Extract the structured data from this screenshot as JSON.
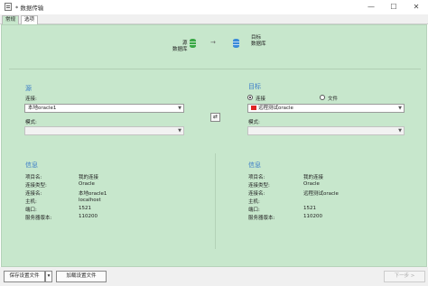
{
  "window": {
    "title": "* 数据传输",
    "minimize": "—",
    "maximize": "☐",
    "close": "✕"
  },
  "tabs": [
    {
      "label": "常规",
      "active": true
    },
    {
      "label": "选项",
      "active": false
    }
  ],
  "banner": {
    "source_label_1": "源",
    "source_label_2": "数据库",
    "target_label_1": "目标",
    "target_label_2": "数据库",
    "arrow": "→"
  },
  "source": {
    "heading": "源",
    "connection_label": "连接:",
    "connection_value": "本地oracle1",
    "schema_label": "模式:",
    "schema_value": ""
  },
  "target": {
    "heading": "目标",
    "radio_connection": "连接",
    "radio_file": "文件",
    "connection_value": "远程测试oracle",
    "schema_label": "模式:",
    "schema_value": ""
  },
  "swap_icon": "⇄",
  "source_info": {
    "heading": "信息",
    "rows": [
      {
        "key": "项目名:",
        "value": "我的连接"
      },
      {
        "key": "连接类型:",
        "value": "Oracle"
      },
      {
        "key": "连接名:",
        "value": "本地oracle1"
      },
      {
        "key": "主机:",
        "value": "localhost"
      },
      {
        "key": "端口:",
        "value": "1521"
      },
      {
        "key": "服务器版本:",
        "value": "110200"
      }
    ]
  },
  "target_info": {
    "heading": "信息",
    "rows": [
      {
        "key": "项目名:",
        "value": "我的连接"
      },
      {
        "key": "连接类型:",
        "value": "Oracle"
      },
      {
        "key": "连接名:",
        "value": "远程测试oracle"
      },
      {
        "key": "主机:",
        "value": ""
      },
      {
        "key": "端口:",
        "value": "1521"
      },
      {
        "key": "服务器版本:",
        "value": "110200"
      }
    ]
  },
  "footer": {
    "save_settings": "保存设置文件",
    "dropdown_caret": "▾",
    "load_settings": "加载设置文件",
    "next": "下一步 >"
  }
}
